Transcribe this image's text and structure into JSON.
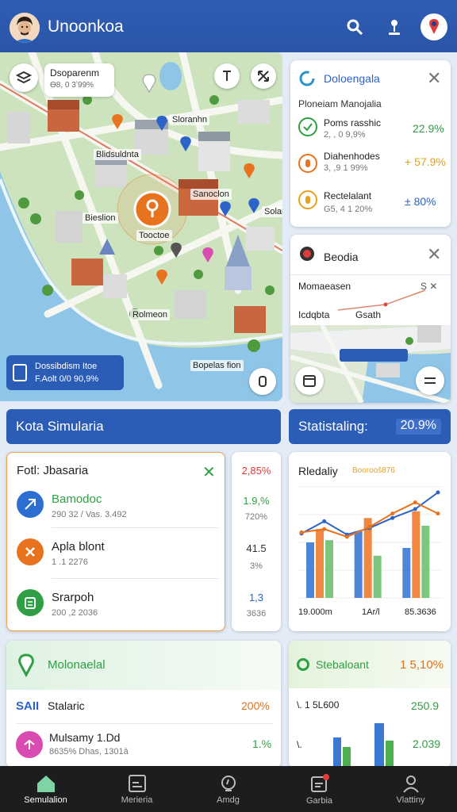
{
  "header": {
    "title": "Unoonkoa"
  },
  "map": {
    "callout_title": "Dsoparenm",
    "callout_sub": "Ѳ8, 0 3ʼ99%",
    "labels": [
      {
        "text": "Sloranhn"
      },
      {
        "text": "Blidsuldnta"
      },
      {
        "text": "Sanoclon"
      },
      {
        "text": "Bieslion"
      },
      {
        "text": "Solam"
      },
      {
        "text": "Tooctoe"
      },
      {
        "text": "Rolmeon"
      },
      {
        "text": "Bopelas fion"
      }
    ],
    "info_box": {
      "line1": "Dossibdism  Itoe",
      "line2": "F.Aolt 0/0   90,9%"
    }
  },
  "right_card_1": {
    "title": "Doloengala",
    "subtitle": "Ploneiam Manojalia",
    "rows": [
      {
        "name": "Poms rasshic",
        "sub": "2, , 0 9,9%",
        "value": "22.9%"
      },
      {
        "name": "Diahenhodes",
        "sub": "3, ,9 1 99%",
        "value": "+ 57.9%"
      },
      {
        "name": "Rectelalant",
        "sub": "G5, 4 1 20%",
        "value": "± 80%"
      }
    ]
  },
  "right_card_2": {
    "title": "Beodia",
    "line1": "Momaeasen",
    "line2a": "Icdqbta",
    "line2b": "Gsath",
    "pill": "",
    "close2": "S ✕"
  },
  "banner_left": {
    "label": "Kota Simularia"
  },
  "banner_right": {
    "label": "Statistaling:",
    "value": "20.9%"
  },
  "list_card": {
    "title": "Fotl: Jbasaria",
    "items": [
      {
        "name": "Bamodoc",
        "sub": "290 32 / Vas. 3.492"
      },
      {
        "name": "Apla blont",
        "sub": "1 .1 2276"
      },
      {
        "name": "Srarpoh",
        "sub": "200 ,2 2036"
      }
    ]
  },
  "stats_column": [
    {
      "value": "2,85%",
      "sub": ""
    },
    {
      "value": "1.9,%",
      "sub": "720%"
    },
    {
      "value": "41.5",
      "sub": "3%"
    },
    {
      "value": "1,3",
      "sub": "3636"
    }
  ],
  "chart_card": {
    "title": "Rledaliy",
    "subtitle": "Boorooš876",
    "xlabels": [
      "19.000m",
      "1Ar/l",
      "85.3636"
    ]
  },
  "chart_data": {
    "type": "bar",
    "categories": [
      "19.000m",
      "1Ar/l",
      "85.3636"
    ],
    "series": [
      {
        "values": [
          5,
          6,
          4.5
        ]
      },
      {
        "values": [
          6.2,
          7.2,
          7.8
        ]
      },
      {
        "values": [
          5.2,
          3.8,
          6.5
        ]
      }
    ],
    "line_series": [
      {
        "values": [
          5.8,
          6.9,
          5.7,
          6.3,
          7.2,
          8.0,
          9.5
        ]
      },
      {
        "values": [
          5.9,
          6.2,
          5.5,
          6.4,
          7.6,
          8.6,
          7.6
        ]
      }
    ],
    "ylim": [
      0,
      10
    ]
  },
  "bottom_left": {
    "title": "Molonaelal",
    "rows": [
      {
        "name": "Stalaric",
        "prefix": "SAII",
        "value": "200%"
      },
      {
        "name": "Mulsamy 1.Dd",
        "sub": "8635%  Dhas, 1301ā",
        "value": "1.%"
      }
    ]
  },
  "bottom_right": {
    "title": "Stebaloant",
    "value": "1 5,10%",
    "row1_label": "\\. 1 5L600",
    "row1_value": "250.9",
    "row2_label": "\\.",
    "row2_value": "2.039"
  },
  "tabs": [
    {
      "label": "Semulalion"
    },
    {
      "label": "Merieria"
    },
    {
      "label": "Amdg"
    },
    {
      "label": "Garbia"
    },
    {
      "label": "Vlattiny"
    }
  ],
  "colors": {
    "primary": "#2c5db6",
    "green": "#2ea043",
    "orange": "#e8731f",
    "blue": "#2b63c9"
  }
}
